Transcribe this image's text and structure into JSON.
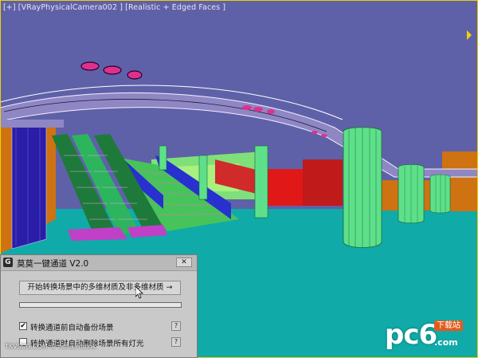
{
  "viewport": {
    "label": "[+] [VRayPhysicalCamera002 ] [Realistic + Edged Faces ]",
    "colors": {
      "sky": "#5f61a8",
      "floor": "#10aaa8",
      "wall_orange": "#ce7212",
      "column_green": "#5ee08a",
      "escalator_green": "#2db55d",
      "accent_red": "#e01818",
      "ceiling_ring": "#8f87c4",
      "blue_panel": "#2a1ea8"
    }
  },
  "dialog": {
    "title": "莫莫一键通道 V2.0",
    "app_icon": "G",
    "close_label": "✕",
    "start_button": "开始转换场景中的多维材质及非多维材质 →",
    "progress_value": 0.0,
    "options": [
      {
        "label": "转换通道前自动备份场景",
        "checked": true,
        "help": "?"
      },
      {
        "label": "转换通道时自动删除场景所有灯光",
        "checked": false,
        "help": "?"
      }
    ]
  },
  "watermark": {
    "left_text": "TKVSCG.COM © nohairmnok",
    "logo_main": "pc6",
    "logo_sub": "下载站",
    "logo_domain": ".com"
  },
  "icons": {
    "cursor": "mouse-pointer-icon",
    "app": "app-logo-icon",
    "close": "close-icon"
  }
}
